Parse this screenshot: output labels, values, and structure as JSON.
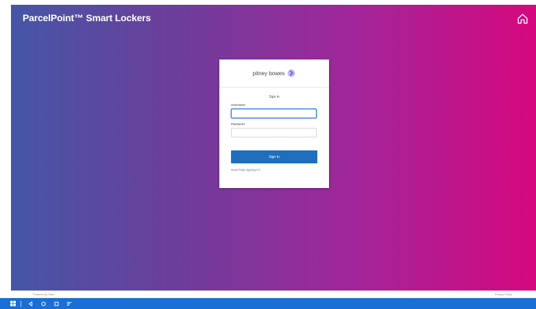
{
  "app": {
    "title": "ParcelPoint™ Smart Lockers"
  },
  "login": {
    "brand": "pitney bowes",
    "heading": "Sign in",
    "username_label": "Username",
    "username_value": "",
    "password_label": "Password",
    "password_value": "",
    "submit_label": "Sign In",
    "help_link": "Need help signing in?"
  },
  "footer": {
    "left": "Powered by Okta",
    "right": "Privacy Policy"
  },
  "taskbar": {
    "icons": [
      "windows-icon",
      "back-icon",
      "home-circle-icon",
      "square-icon",
      "menu-icon"
    ]
  },
  "colors": {
    "gradient_start": "#4556a6",
    "gradient_end": "#d6087e",
    "primary_button": "#1f6fbe",
    "taskbar": "#1a6fd6"
  }
}
